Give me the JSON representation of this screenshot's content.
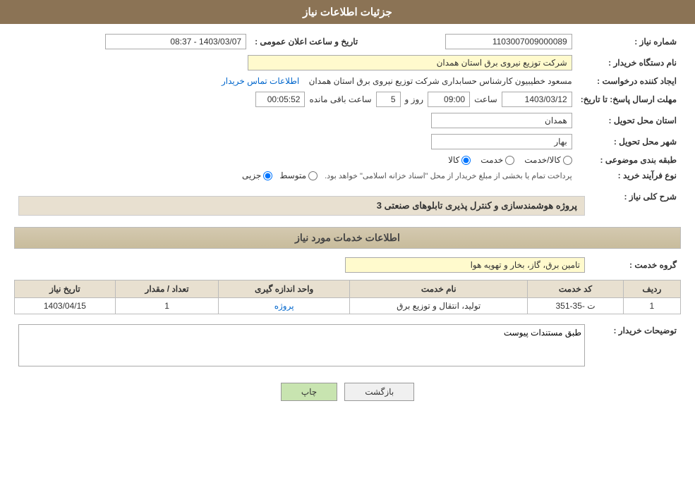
{
  "header": {
    "title": "جزئیات اطلاعات نیاز"
  },
  "fields": {
    "need_number_label": "شماره نیاز :",
    "need_number_value": "1103007009000089",
    "buyer_org_label": "نام دستگاه خریدار :",
    "buyer_org_value": "شرکت توزیع نیروی برق استان همدان",
    "announce_date_label": "تاریخ و ساعت اعلان عمومی :",
    "announce_date_value": "1403/03/07 - 08:37",
    "creator_label": "ایجاد کننده درخواست :",
    "creator_value": "مسعود خطیبیون کارشناس حسابداری شرکت توزیع نیروی برق استان همدان",
    "creator_link": "اطلاعات تماس خریدار",
    "deadline_label": "مهلت ارسال پاسخ: تا تاریخ:",
    "deadline_date": "1403/03/12",
    "deadline_time_label": "ساعت",
    "deadline_time": "09:00",
    "deadline_days_label": "روز و",
    "deadline_days": "5",
    "remaining_label": "ساعت باقی مانده",
    "remaining_time": "00:05:52",
    "province_label": "استان محل تحویل :",
    "province_value": "همدان",
    "city_label": "شهر محل تحویل :",
    "city_value": "بهار",
    "category_label": "طبقه بندی موضوعی :",
    "category_options": [
      "کالا",
      "خدمت",
      "کالا/خدمت"
    ],
    "category_selected": "کالا",
    "purchase_type_label": "نوع فرآیند خرید :",
    "purchase_type_options": [
      "جزیی",
      "متوسط"
    ],
    "purchase_type_note": "پرداخت تمام یا بخشی از مبلغ خریدار از محل \"اسناد خزانه اسلامی\" خواهد بود.",
    "need_desc_label": "شرح کلی نیاز :",
    "need_desc_value": "پروژه هوشمندسازی و کنترل پذیری تابلوهای صنعتی 3",
    "services_section": "اطلاعات خدمات مورد نیاز",
    "service_group_label": "گروه خدمت :",
    "service_group_value": "تامین برق، گاز، بخار و تهویه هوا",
    "table": {
      "headers": [
        "ردیف",
        "کد خدمت",
        "نام خدمت",
        "واحد اندازه گیری",
        "تعداد / مقدار",
        "تاریخ نیاز"
      ],
      "rows": [
        {
          "row": "1",
          "code": "ت -35-351",
          "name": "تولید، انتقال و توزیع برق",
          "unit": "پروژه",
          "quantity": "1",
          "date": "1403/04/15"
        }
      ]
    },
    "buyer_desc_label": "توضیحات خریدار :",
    "buyer_desc_value": "طبق مستندات پیوست"
  },
  "buttons": {
    "print": "چاپ",
    "back": "بازگشت"
  }
}
